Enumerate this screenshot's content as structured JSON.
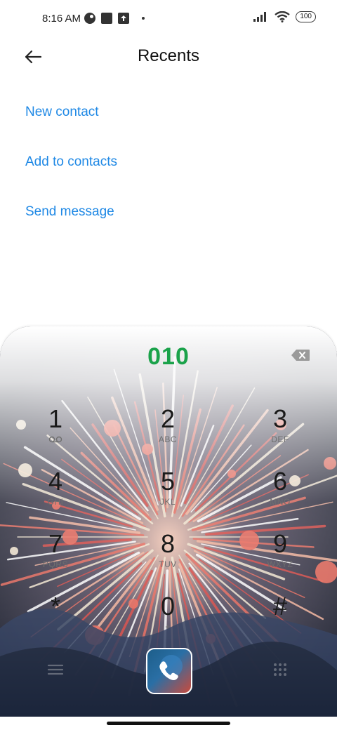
{
  "status_bar": {
    "time": "8:16 AM",
    "battery": "100",
    "left_icons": [
      "vpn-icon",
      "notification-square-icon",
      "upload-icon",
      "dot-icon"
    ],
    "right_icons": [
      "signal-icon",
      "wifi-icon",
      "battery-icon"
    ]
  },
  "header": {
    "title": "Recents",
    "back_icon": "arrow-left-icon"
  },
  "actions": {
    "new_contact": "New contact",
    "add_to_contacts": "Add to contacts",
    "send_message": "Send message",
    "color": "#1e88e5"
  },
  "dialer": {
    "number": "010",
    "number_color": "#1aa24a",
    "backspace_icon": "backspace-icon",
    "keys": [
      {
        "digit": "1",
        "letters": "",
        "sub_icon": "voicemail-icon"
      },
      {
        "digit": "2",
        "letters": "ABC"
      },
      {
        "digit": "3",
        "letters": "DEF"
      },
      {
        "digit": "4",
        "letters": "GHI"
      },
      {
        "digit": "5",
        "letters": "JKL"
      },
      {
        "digit": "6",
        "letters": "MNO"
      },
      {
        "digit": "7",
        "letters": "PQRS"
      },
      {
        "digit": "8",
        "letters": "TUV"
      },
      {
        "digit": "9",
        "letters": "WXYZ"
      },
      {
        "digit": "*",
        "letters": ""
      },
      {
        "digit": "0",
        "letters": "+"
      },
      {
        "digit": "#",
        "letters": ""
      }
    ],
    "call_icon": "phone-icon",
    "menu_icon": "menu-icon",
    "dialpad_icon": "dialpad-icon"
  }
}
